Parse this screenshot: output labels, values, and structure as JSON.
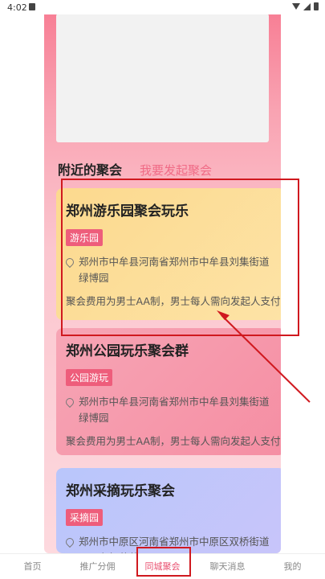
{
  "status_bar": {
    "time": "4:02"
  },
  "section_tabs": {
    "active": "附近的聚会",
    "other": "我要发起聚会"
  },
  "cards": [
    {
      "title": "郑州游乐园聚会玩乐",
      "tag": "游乐园",
      "address": "郑州市中牟县河南省郑州市中牟县刘集街道绿博园",
      "note": "聚会费用为男士AA制，男士每人需向发起人支付"
    },
    {
      "title": "郑州公园玩乐聚会群",
      "tag": "公园游玩",
      "address": "郑州市中牟县河南省郑州市中牟县刘集街道绿博园",
      "note": "聚会费用为男士AA制，男士每人需向发起人支付"
    },
    {
      "title": "郑州采摘玩乐聚会",
      "tag": "采摘园",
      "address": "郑州市中原区河南省郑州市中原区双桥街道田园有机草莓园",
      "note": ""
    }
  ],
  "bottom_nav": [
    {
      "label": "首页",
      "active": false
    },
    {
      "label": "推广分佣",
      "active": false
    },
    {
      "label": "同城聚会",
      "active": true
    },
    {
      "label": "聊天消息",
      "active": false
    },
    {
      "label": "我的",
      "active": false
    }
  ],
  "colors": {
    "accent": "#e9506f",
    "annotation": "#d0191f"
  }
}
